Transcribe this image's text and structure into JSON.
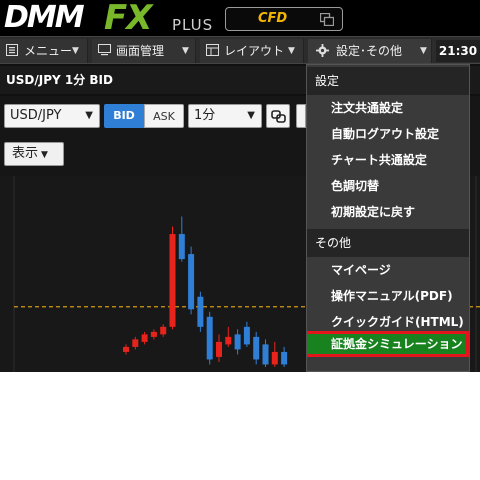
{
  "brand": {
    "logo_main": "DMM",
    "logo_fx": "FX",
    "logo_plus": "PLUS",
    "cfd_label": "CFD",
    "cfd_icon": "windows-icon"
  },
  "menubar": {
    "menu_label": "メニュー",
    "screen_label": "画面管理",
    "layout_label": "レイアウト",
    "settings_label": "設定･その他",
    "clock": "21:30"
  },
  "panel": {
    "title": "USD/JPY 1分 BID",
    "symbol_value": "USD/JPY",
    "bid_label": "BID",
    "ask_label": "ASK",
    "timeframe_value": "1分",
    "display_label": "表示"
  },
  "dropdown": {
    "section_settings": "設定",
    "settings_items": [
      "注文共通設定",
      "自動ログアウト設定",
      "チャート共通設定",
      "色調切替",
      "初期設定に戻す"
    ],
    "section_other": "その他",
    "other_items": [
      "マイページ",
      "操作マニュアル(PDF)",
      "クイックガイド(HTML)",
      "証拠金シミュレーション"
    ],
    "highlighted_item": "証拠金シミュレーション"
  },
  "colors": {
    "up_candle": "#e8231c",
    "down_candle": "#2f7fd6",
    "price_line": "#d49a12",
    "highlight_bg": "#17821e",
    "highlight_border": "#e3141b",
    "bid_active": "#2f7fd6"
  },
  "chart_data": {
    "type": "candlestick",
    "reference_line": "dashed horizontal price line",
    "candles": [
      {
        "dir": "up",
        "o": 8,
        "c": 10,
        "h": 11,
        "l": 7
      },
      {
        "dir": "up",
        "o": 10,
        "c": 13,
        "h": 14,
        "l": 9
      },
      {
        "dir": "up",
        "o": 12,
        "c": 15,
        "h": 16,
        "l": 11
      },
      {
        "dir": "up",
        "o": 14,
        "c": 16,
        "h": 17,
        "l": 13
      },
      {
        "dir": "up",
        "o": 15,
        "c": 18,
        "h": 19,
        "l": 14
      },
      {
        "dir": "up",
        "o": 18,
        "c": 55,
        "h": 58,
        "l": 17
      },
      {
        "dir": "down",
        "o": 55,
        "c": 45,
        "h": 62,
        "l": 44
      },
      {
        "dir": "down",
        "o": 47,
        "c": 25,
        "h": 50,
        "l": 23
      },
      {
        "dir": "down",
        "o": 30,
        "c": 18,
        "h": 32,
        "l": 16
      },
      {
        "dir": "down",
        "o": 22,
        "c": 5,
        "h": 24,
        "l": 3
      },
      {
        "dir": "up",
        "o": 6,
        "c": 12,
        "h": 15,
        "l": 4
      },
      {
        "dir": "up",
        "o": 11,
        "c": 14,
        "h": 18,
        "l": 10
      },
      {
        "dir": "down",
        "o": 15,
        "c": 9,
        "h": 17,
        "l": 7
      },
      {
        "dir": "down",
        "o": 18,
        "c": 11,
        "h": 20,
        "l": 10
      },
      {
        "dir": "down",
        "o": 14,
        "c": 5,
        "h": 16,
        "l": 3
      },
      {
        "dir": "down",
        "o": 11,
        "c": 3,
        "h": 13,
        "l": 2
      },
      {
        "dir": "up",
        "o": 3,
        "c": 8,
        "h": 12,
        "l": 2
      },
      {
        "dir": "down",
        "o": 8,
        "c": 3,
        "h": 10,
        "l": 2
      }
    ],
    "price_line_value": 26,
    "ylim": [
      0,
      75
    ]
  }
}
